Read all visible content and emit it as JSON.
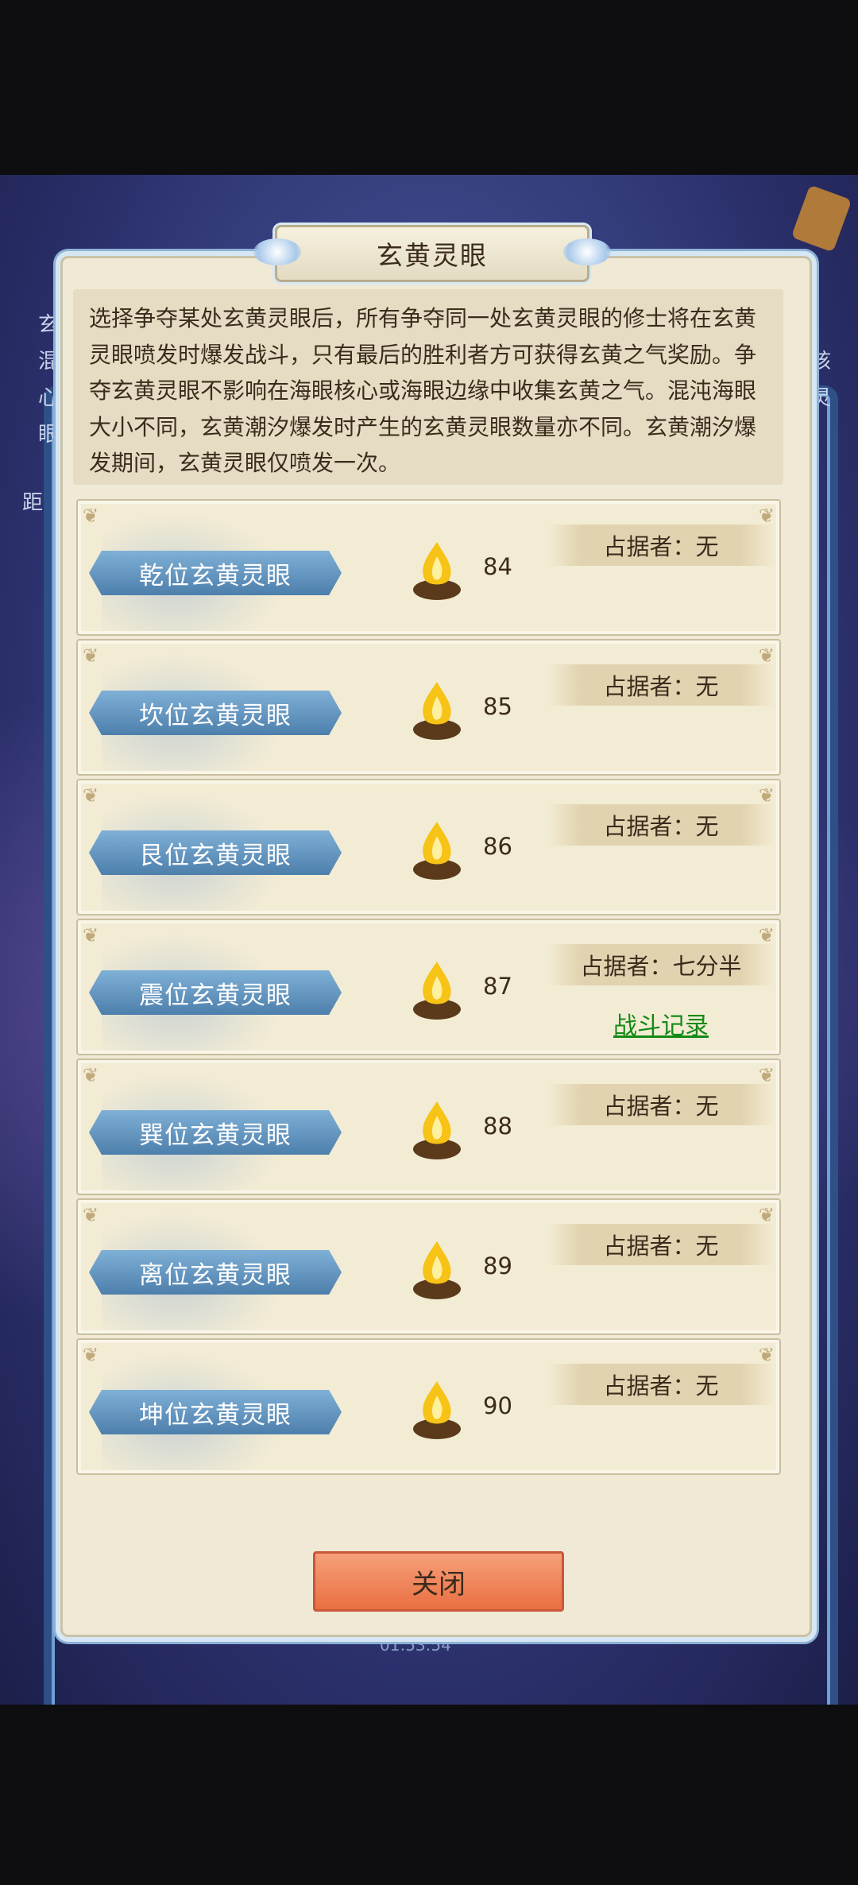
{
  "dialog": {
    "title": "玄黄灵眼",
    "description": "选择争夺某处玄黄灵眼后，所有争夺同一处玄黄灵眼的修士将在玄黄灵眼喷发时爆发战斗，只有最后的胜利者方可获得玄黄之气奖励。争夺玄黄灵眼不影响在海眼核心或海眼边缘中收集玄黄之气。混沌海眼大小不同，玄黄潮汐爆发时产生的玄黄灵眼数量亦不同。玄黄潮汐爆发期间，玄黄灵眼仅喷发一次。",
    "close_label": "关闭"
  },
  "spirit_eyes": [
    {
      "name": "乾位玄黄灵眼",
      "value": "84",
      "owner": "占据者：无",
      "battle_record": ""
    },
    {
      "name": "坎位玄黄灵眼",
      "value": "85",
      "owner": "占据者：无",
      "battle_record": ""
    },
    {
      "name": "艮位玄黄灵眼",
      "value": "86",
      "owner": "占据者：无",
      "battle_record": ""
    },
    {
      "name": "震位玄黄灵眼",
      "value": "87",
      "owner": "占据者：七分半",
      "battle_record": "战斗记录"
    },
    {
      "name": "巽位玄黄灵眼",
      "value": "88",
      "owner": "占据者：无",
      "battle_record": ""
    },
    {
      "name": "离位玄黄灵眼",
      "value": "89",
      "owner": "占据者：无",
      "battle_record": ""
    },
    {
      "name": "坤位玄黄灵眼",
      "value": "90",
      "owner": "占据者：无",
      "battle_record": ""
    }
  ],
  "background": {
    "timer": "01:53:54",
    "left_glyphs": [
      "玄",
      "混",
      "心",
      "眼",
      "距"
    ],
    "right_glyphs": [
      "核",
      "灵"
    ]
  },
  "icons": {
    "fire": "golden-flame-cauldron-icon",
    "corner": "scroll-corner-icon"
  },
  "colors": {
    "accent_button": "#ea6f42",
    "banner": "#5f90bd",
    "link_green": "#138a16",
    "panel": "#efe9d5"
  }
}
